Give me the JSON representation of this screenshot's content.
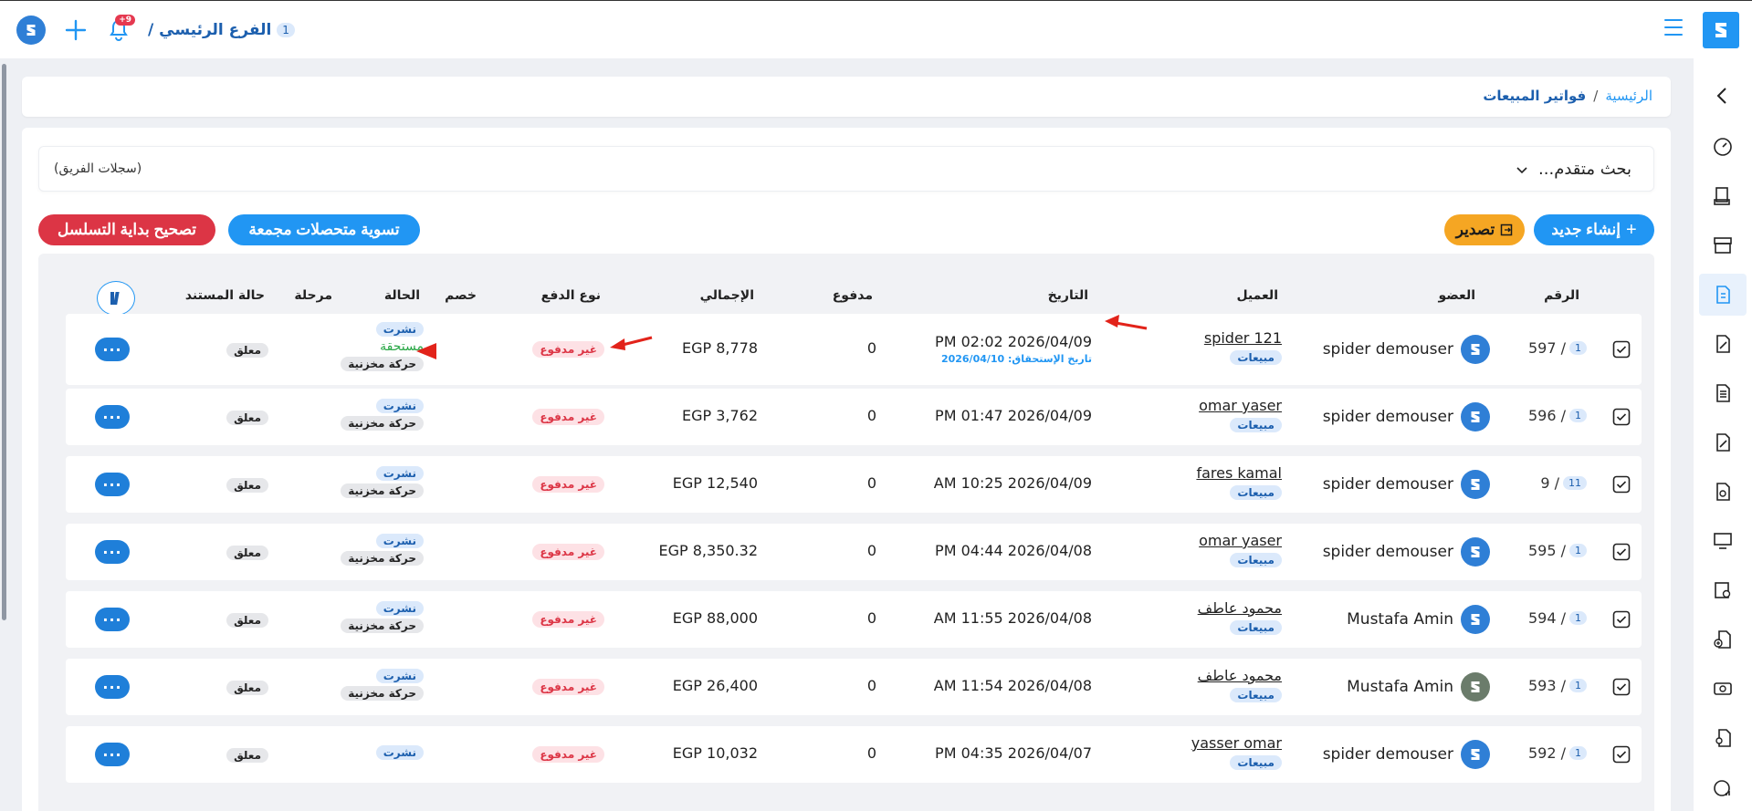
{
  "topbar": {
    "branch_name": "الفرع الرئيسي /",
    "branch_count": "1",
    "notif_badge": "+9"
  },
  "breadcrumb": {
    "home": "الرئيسية",
    "separator": "/",
    "current": "فواتير المبيعات"
  },
  "search": {
    "advanced_label": "بحث متقدم...",
    "team_logs": "(سجلات الفريق)"
  },
  "actions": {
    "new_label": "إنشاء جديد",
    "export_label": "تصدير",
    "settle_label": "تسوية متحصلات مجمعة",
    "fix_label": "تصحيح بداية التسلسل"
  },
  "table": {
    "headers": {
      "number": "الرقم",
      "member": "العضو",
      "client": "العميل",
      "date": "التاريخ",
      "paid": "مدفوع",
      "total": "الإجمالي",
      "payment_type": "نوع الدفع",
      "discount": "خصم",
      "status": "الحالة",
      "stage": "مرحلة",
      "doc_status": "حالة المستند"
    },
    "rows": [
      {
        "num": "597 /",
        "pill": "1",
        "member": "spider demouser",
        "client": "spider 121",
        "client_tag": "مبيعات",
        "date": "PM 02:02 2026/04/09",
        "due": "تاريخ الإستحقاق: 2026/04/10",
        "paid": "0",
        "total": "EGP 8,778",
        "pay": "غير مدفوع",
        "published": "نشرت",
        "due_status": "مستحقة",
        "stock": "حركة مخزنية",
        "doc": "معلق"
      },
      {
        "num": "596 /",
        "pill": "1",
        "member": "spider demouser",
        "client": "omar yaser",
        "client_tag": "مبيعات",
        "date": "PM 01:47 2026/04/09",
        "paid": "0",
        "total": "EGP 3,762",
        "pay": "غير مدفوع",
        "published": "نشرت",
        "stock": "حركة مخزنية",
        "doc": "معلق"
      },
      {
        "num": "9 /",
        "pill": "11",
        "member": "spider demouser",
        "client": "fares kamal",
        "client_tag": "مبيعات",
        "date": "AM 10:25 2026/04/09",
        "paid": "0",
        "total": "EGP 12,540",
        "pay": "غير مدفوع",
        "published": "نشرت",
        "stock": "حركة مخزنية",
        "doc": "معلق"
      },
      {
        "num": "595 /",
        "pill": "1",
        "member": "spider demouser",
        "client": "omar yaser",
        "client_tag": "مبيعات",
        "date": "PM 04:44 2026/04/08",
        "paid": "0",
        "total": "EGP 8,350.32",
        "pay": "غير مدفوع",
        "published": "نشرت",
        "stock": "حركة مخزنية",
        "doc": "معلق"
      },
      {
        "num": "594 /",
        "pill": "1",
        "member": "Mustafa Amin",
        "client": "محمود عاطف",
        "client_tag": "مبيعات",
        "date": "AM 11:55 2026/04/08",
        "paid": "0",
        "total": "EGP 88,000",
        "pay": "غير مدفوع",
        "published": "نشرت",
        "stock": "حركة مخزنية",
        "doc": "معلق"
      },
      {
        "num": "593 /",
        "pill": "1",
        "member": "Mustafa Amin",
        "client": "محمود عاطف",
        "client_tag": "مبيعات",
        "date": "AM 11:54 2026/04/08",
        "paid": "0",
        "total": "EGP 26,400",
        "pay": "غير مدفوع",
        "published": "نشرت",
        "stock": "حركة مخزنية",
        "doc": "معلق"
      },
      {
        "num": "592 /",
        "pill": "1",
        "member": "spider demouser",
        "client": "yasser omar",
        "client_tag": "مبيعات",
        "date": "PM 04:35 2026/04/07",
        "paid": "0",
        "total": "EGP 10,032",
        "pay": "غير مدفوع",
        "published": "نشرت",
        "doc": "معلق"
      }
    ],
    "actions_glyph": "···"
  },
  "colors": {
    "primary": "#2196f3",
    "danger": "#dc3545",
    "warning": "#f5a623",
    "success": "#28a745"
  }
}
